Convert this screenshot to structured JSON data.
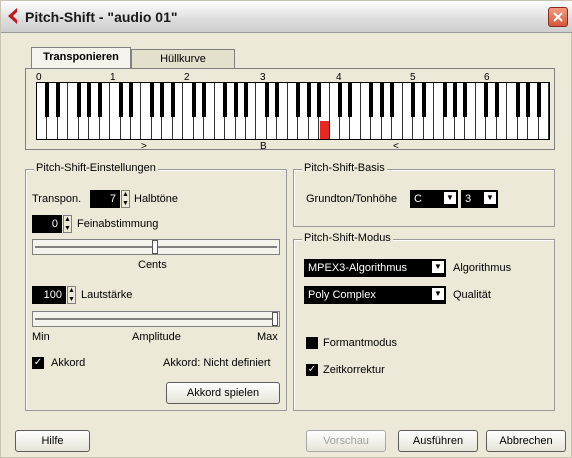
{
  "window": {
    "title": "Pitch-Shift - \"audio 01\""
  },
  "tabs": [
    {
      "label": "Transponieren"
    },
    {
      "label": "Hüllkurve"
    }
  ],
  "keyboard": {
    "octave_labels": [
      "0",
      "1",
      "2",
      "3",
      "4",
      "5",
      "6"
    ],
    "left_marker": ">",
    "center_marker": "B",
    "right_marker": "<",
    "highlight_color": "#e8281e"
  },
  "settings": {
    "title": "Pitch-Shift-Einstellungen",
    "transpose_label": "Transpon.",
    "transpose_value": "7",
    "semitones_label": "Halbtöne",
    "finetune_value": "0",
    "finetune_label": "Feinabstimmung",
    "cents_label": "Cents",
    "volume_value": "100",
    "volume_label": "Lautstärke",
    "amp_min": "Min",
    "amp_label": "Amplitude",
    "amp_max": "Max",
    "chord_label": "Akkord",
    "chord_checked": true,
    "chord_status": "Akkord: Nicht definiert",
    "play_chord": "Akkord spielen"
  },
  "basis": {
    "title": "Pitch-Shift-Basis",
    "root_label": "Grundton/Tonhöhe",
    "note": "C",
    "octave": "3"
  },
  "mode": {
    "title": "Pitch-Shift-Modus",
    "algorithm": "MPEX3-Algorithmus",
    "algorithm_label": "Algorithmus",
    "quality": "Poly Complex",
    "quality_label": "Qualität",
    "formant_label": "Formantmodus",
    "formant_checked": false,
    "timecorr_label": "Zeitkorrektur",
    "timecorr_checked": true
  },
  "footer": {
    "help": "Hilfe",
    "preview": "Vorschau",
    "execute": "Ausführen",
    "cancel": "Abbrechen"
  }
}
